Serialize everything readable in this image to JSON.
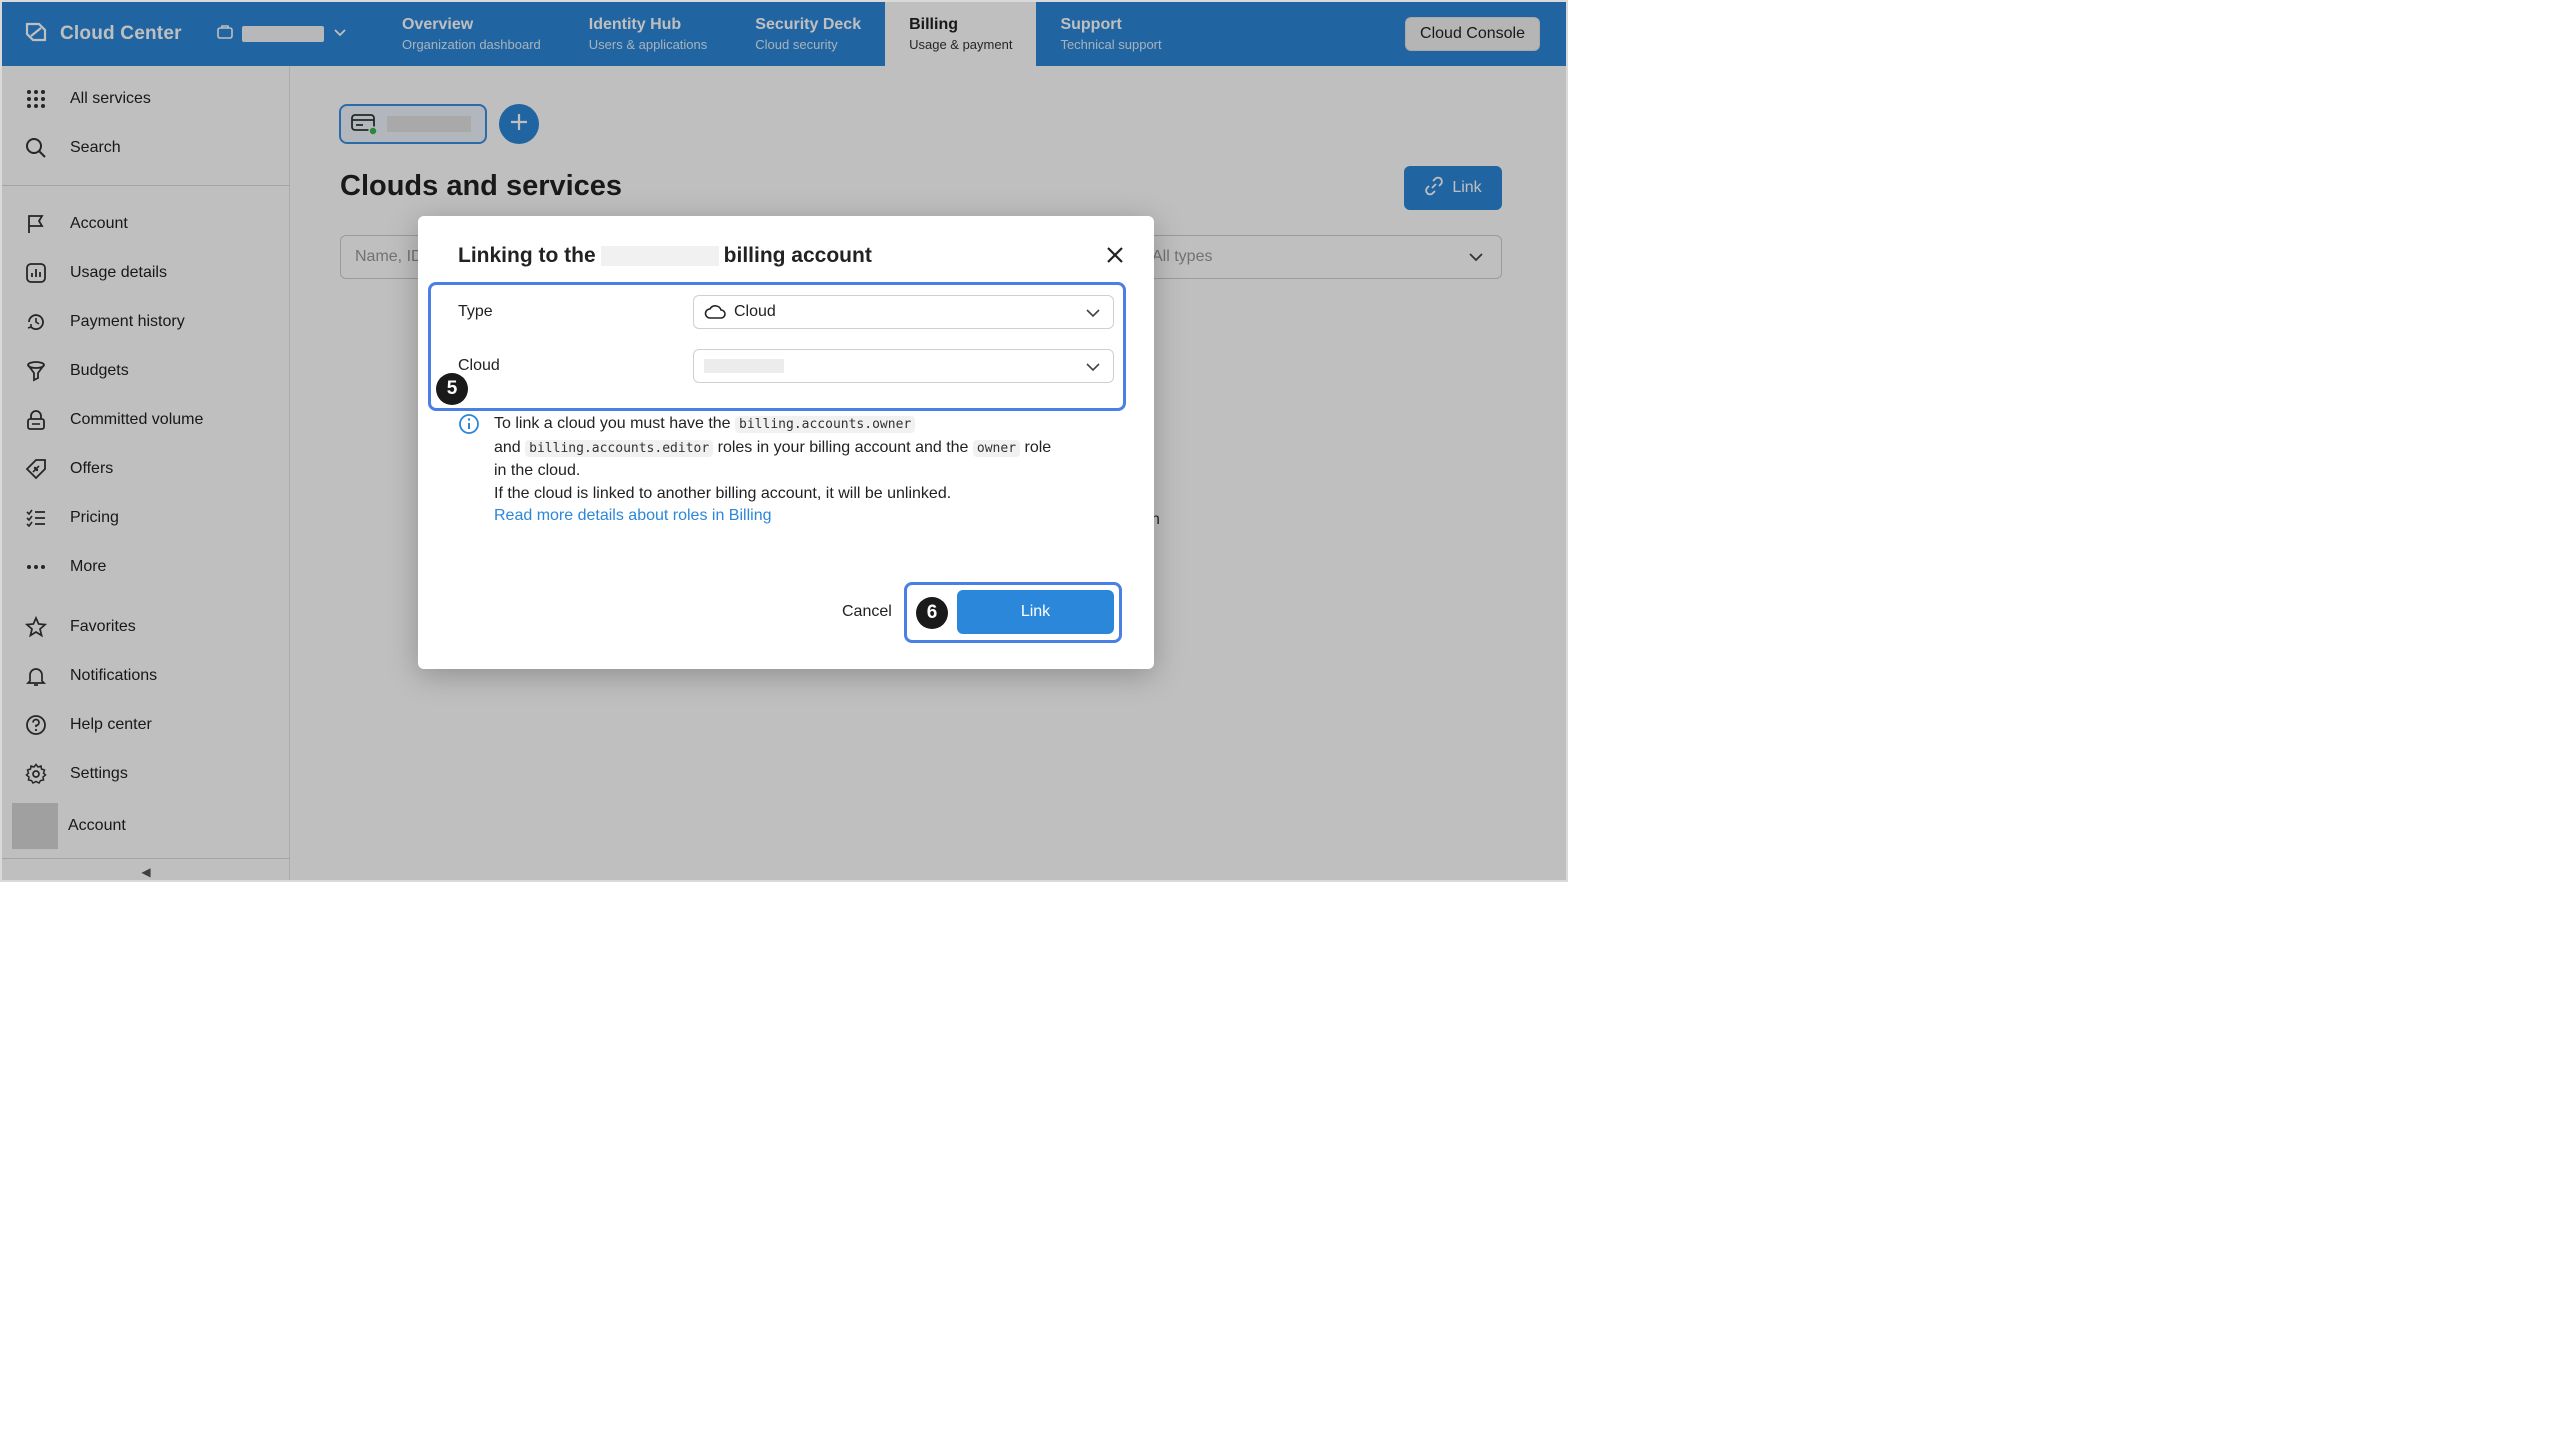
{
  "header": {
    "brand": "Cloud Center",
    "tabs": [
      {
        "title": "Overview",
        "subtitle": "Organization dashboard"
      },
      {
        "title": "Identity Hub",
        "subtitle": "Users & applications"
      },
      {
        "title": "Security Deck",
        "subtitle": "Cloud security"
      },
      {
        "title": "Billing",
        "subtitle": "Usage & payment"
      },
      {
        "title": "Support",
        "subtitle": "Technical support"
      }
    ],
    "console_button": "Cloud Console"
  },
  "sidebar": {
    "items": [
      {
        "label": "All services",
        "icon": "grid-icon"
      },
      {
        "label": "Search",
        "icon": "search-icon"
      },
      {
        "label": "Account",
        "icon": "flag-icon"
      },
      {
        "label": "Usage details",
        "icon": "chart-icon"
      },
      {
        "label": "Payment history",
        "icon": "history-icon"
      },
      {
        "label": "Budgets",
        "icon": "funnel-icon"
      },
      {
        "label": "Committed volume",
        "icon": "lock-icon"
      },
      {
        "label": "Offers",
        "icon": "tag-icon"
      },
      {
        "label": "Pricing",
        "icon": "list-icon"
      },
      {
        "label": "More",
        "icon": "dots-icon"
      },
      {
        "label": "Favorites",
        "icon": "star-icon"
      },
      {
        "label": "Notifications",
        "icon": "bell-icon"
      },
      {
        "label": "Help center",
        "icon": "help-icon"
      },
      {
        "label": "Settings",
        "icon": "gear-icon"
      },
      {
        "label": "Account",
        "icon": "avatar"
      }
    ],
    "collapse_glyph": "◀"
  },
  "main": {
    "title": "Clouds and services",
    "link_button": "Link",
    "filter_placeholder": "Name, ID",
    "filter_type": "All types",
    "background_fragment": "h"
  },
  "dialog": {
    "title_prefix": "Linking to the",
    "title_suffix": "billing account",
    "type_label": "Type",
    "type_value": "Cloud",
    "cloud_label": "Cloud",
    "step_5": "5",
    "step_6": "6",
    "info": {
      "line1_text": "To link a cloud you must have the",
      "role_owner": "billing.accounts.owner",
      "and": "and",
      "role_editor": "billing.accounts.editor",
      "line2_text": "roles in your billing account and the",
      "role_cloud_owner": "owner",
      "role_word": "role",
      "line3_text": "in the cloud.",
      "line4_text": "If the cloud is linked to another billing account, it will be unlinked.",
      "link_text": "Read more details about roles in Billing"
    },
    "cancel": "Cancel",
    "confirm": "Link"
  },
  "colors": {
    "accent": "#2b87d9",
    "highlight": "#4a7fe6",
    "status_online": "#3bb34a"
  }
}
